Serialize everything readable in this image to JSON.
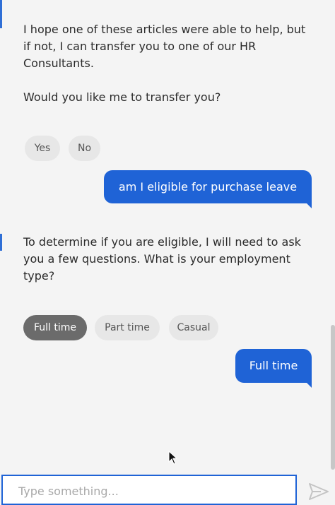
{
  "messages": {
    "bot1": "I hope one of these articles were able to help, but if not, I can transfer you to one of our HR Consultants.",
    "bot2": "Would you like me to transfer you?",
    "transfer_options": [
      "Yes",
      "No"
    ],
    "user1": "am I eligible for purchase leave",
    "bot3": "To determine if you are eligible, I will need to ask you a few questions. What is your employment type?",
    "employment_options": [
      "Full time",
      "Part time",
      "Casual"
    ],
    "selected_employment": "Full time",
    "user2": "Full time"
  },
  "composer": {
    "placeholder": "Type something..."
  },
  "icons": {
    "send": "send-icon",
    "cursor": "mouse-pointer-icon"
  },
  "colors": {
    "accent": "#1f63d6",
    "chip": "#e7e7e7",
    "chip_selected": "#6b6b6b"
  }
}
